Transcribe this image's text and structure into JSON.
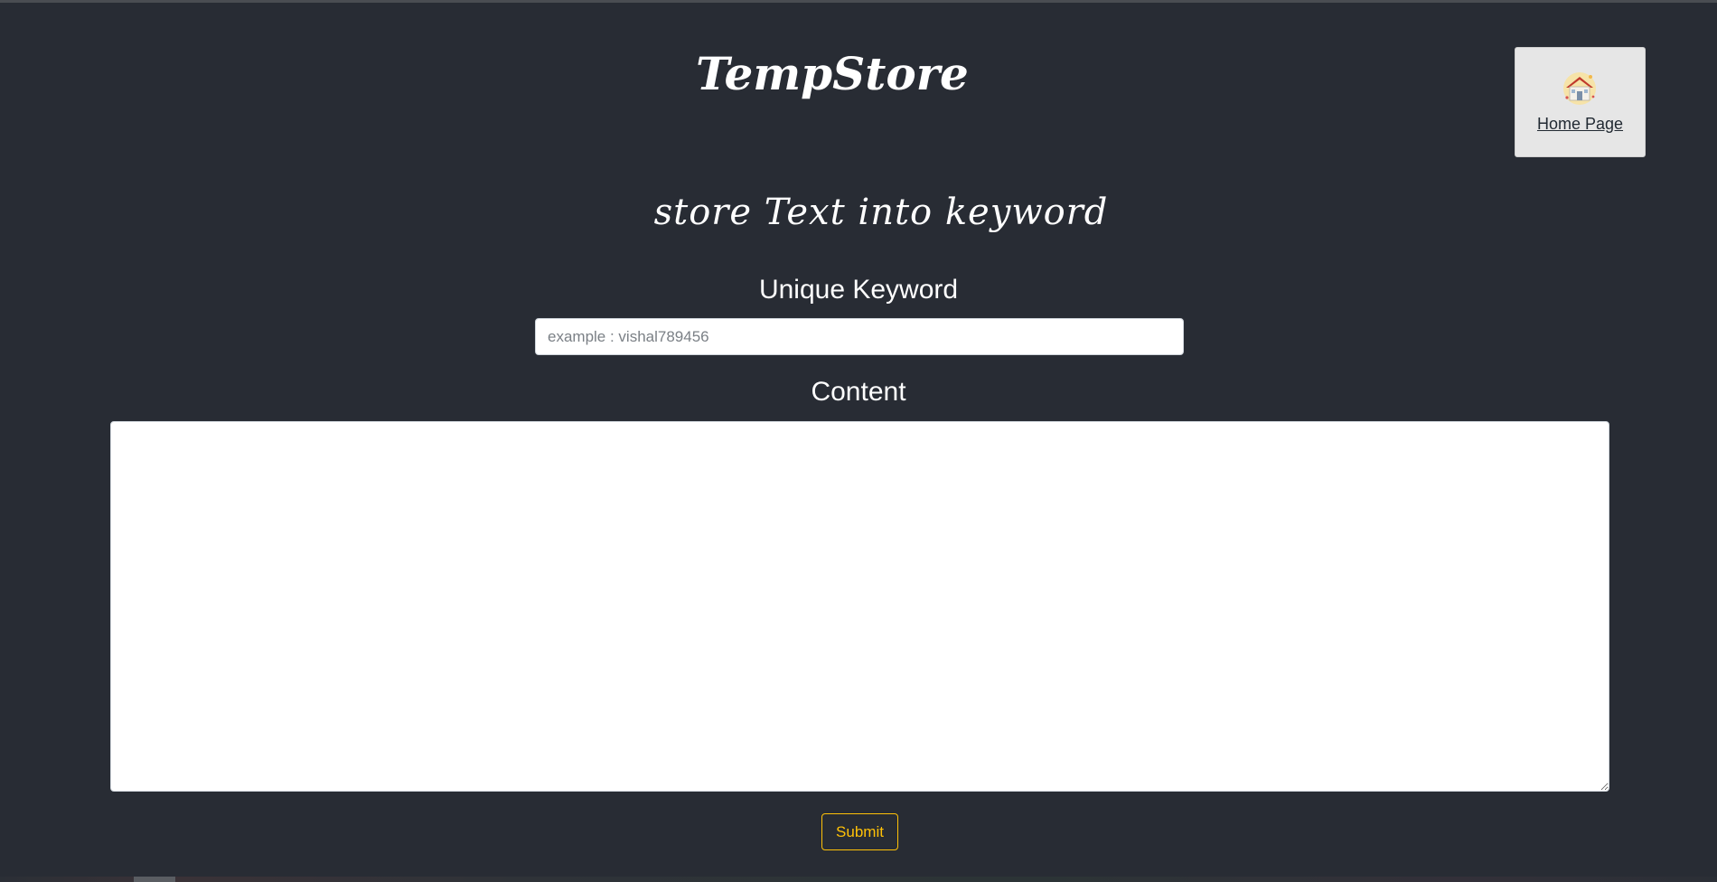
{
  "header": {
    "brand": "TempStore",
    "home_link": {
      "label": "Home Page",
      "icon": "house-icon"
    }
  },
  "main": {
    "tagline": "store Text into keyword",
    "keyword_label": "Unique Keyword",
    "keyword_placeholder": "example : vishal789456",
    "keyword_value": "",
    "content_label": "Content",
    "content_value": "",
    "submit_label": "Submit"
  },
  "colors": {
    "background": "#282c34",
    "accent": "#ffc107",
    "card": "#e6e6e6"
  }
}
